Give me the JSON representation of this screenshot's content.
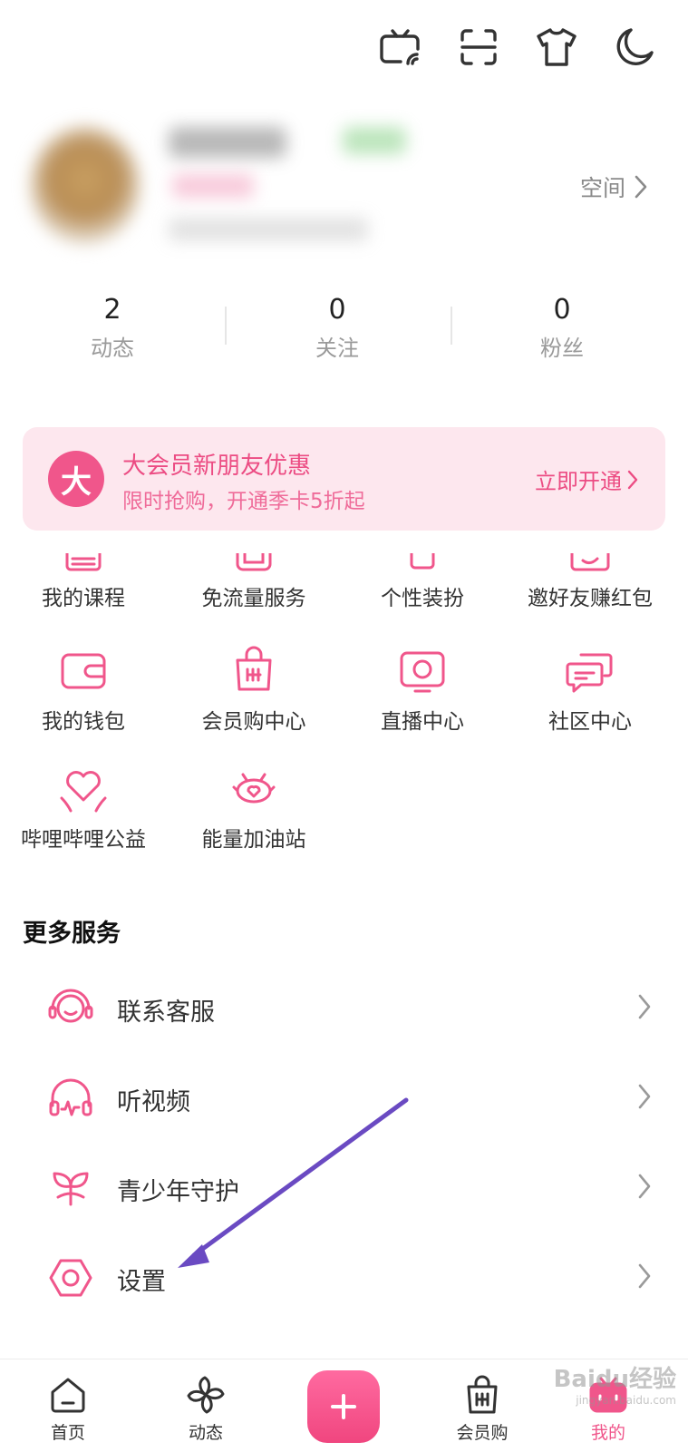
{
  "colors": {
    "accent": "#f0568b",
    "vip_bg": "#fde7ee",
    "arrow": "#6a4ac2"
  },
  "header": {
    "icons": [
      "cast-tv-icon",
      "scan-icon",
      "tshirt-icon",
      "moon-icon"
    ]
  },
  "profile": {
    "space_label": "空间"
  },
  "stats": [
    {
      "value": "2",
      "label": "动态"
    },
    {
      "value": "0",
      "label": "关注"
    },
    {
      "value": "0",
      "label": "粉丝"
    }
  ],
  "vip_banner": {
    "logo_char": "大",
    "title": "大会员新朋友优惠",
    "subtitle": "限时抢购，开通季卡5折起",
    "action": "立即开通"
  },
  "services": [
    {
      "label": "我的课程",
      "icon": "course-icon"
    },
    {
      "label": "免流量服务",
      "icon": "free-data-icon"
    },
    {
      "label": "个性装扮",
      "icon": "dressup-icon"
    },
    {
      "label": "邀好友赚红包",
      "icon": "invite-icon"
    },
    {
      "label": "我的钱包",
      "icon": "wallet-icon"
    },
    {
      "label": "会员购中心",
      "icon": "shopping-bag-icon"
    },
    {
      "label": "直播中心",
      "icon": "live-tv-icon"
    },
    {
      "label": "社区中心",
      "icon": "chat-bubbles-icon"
    },
    {
      "label": "哔哩哔哩公益",
      "icon": "heart-hands-icon"
    },
    {
      "label": "能量加油站",
      "icon": "energy-station-icon"
    }
  ],
  "more_services": {
    "title": "更多服务",
    "items": [
      {
        "label": "联系客服",
        "icon": "customer-service-icon"
      },
      {
        "label": "听视频",
        "icon": "headphones-icon"
      },
      {
        "label": "青少年守护",
        "icon": "sprout-icon"
      },
      {
        "label": "设置",
        "icon": "gear-icon"
      }
    ]
  },
  "tabbar": {
    "items": [
      {
        "label": "首页",
        "icon": "home-icon"
      },
      {
        "label": "动态",
        "icon": "pinwheel-icon"
      },
      {
        "label": "会员购",
        "icon": "shopping-bag-icon"
      },
      {
        "label": "我的",
        "icon": "tv-mascot-icon"
      }
    ]
  },
  "watermark": {
    "text": "Baidu经验",
    "subtext": "jingyan.baidu.com"
  }
}
